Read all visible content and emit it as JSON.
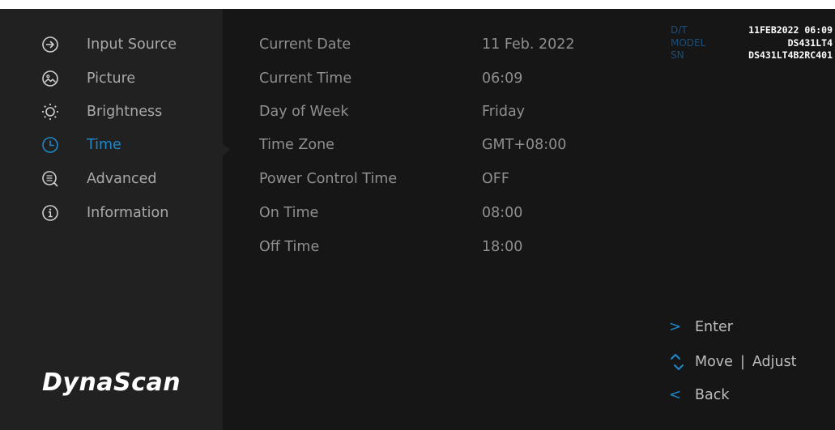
{
  "sidebar": {
    "items": [
      {
        "label": "Input Source",
        "icon": "input-source-icon"
      },
      {
        "label": "Picture",
        "icon": "picture-icon"
      },
      {
        "label": "Brightness",
        "icon": "brightness-icon"
      },
      {
        "label": "Time",
        "icon": "clock-icon",
        "active": true
      },
      {
        "label": "Advanced",
        "icon": "advanced-icon"
      },
      {
        "label": "Information",
        "icon": "info-icon"
      }
    ],
    "logo": "DynaScan"
  },
  "settings": [
    {
      "label": "Current Date",
      "value": "11 Feb. 2022"
    },
    {
      "label": "Current Time",
      "value": "06:09"
    },
    {
      "label": "Day of Week",
      "value": "Friday"
    },
    {
      "label": "Time Zone",
      "value": "GMT+08:00"
    },
    {
      "label": "Power Control Time",
      "value": "OFF"
    },
    {
      "label": "On Time",
      "value": "08:00"
    },
    {
      "label": "Off Time",
      "value": "18:00"
    }
  ],
  "info": {
    "dt_label": "D/T",
    "dt_value": "11FEB2022 06:09",
    "model_label": "MODEL",
    "model_value": "DS431LT4",
    "sn_label": "SN",
    "sn_value": "DS431LT4B2RC401"
  },
  "hints": {
    "enter_symbol": ">",
    "enter": "Enter",
    "move": "Move",
    "separator": "|",
    "adjust": "Adjust",
    "back_symbol": "<",
    "back": "Back"
  },
  "colors": {
    "accent": "#1e88c9",
    "background": "#161616",
    "sidebar": "#212121"
  }
}
